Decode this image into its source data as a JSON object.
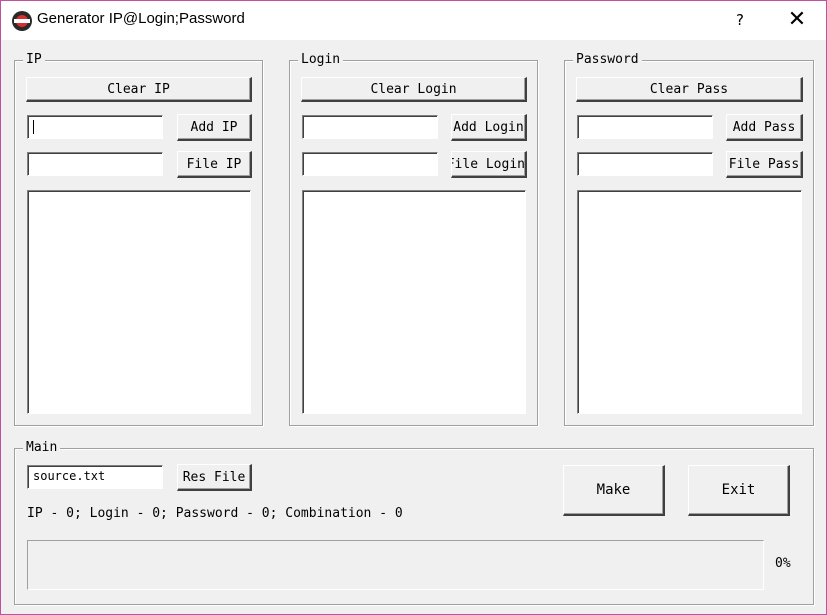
{
  "window": {
    "title": "Generator IP@Login;Password",
    "help_label": "?",
    "close_label": "✕"
  },
  "ip_group": {
    "legend": "IP",
    "clear_label": "Clear IP",
    "add_label": "Add IP",
    "file_label": "File IP",
    "add_value": "",
    "file_value": "",
    "items": []
  },
  "login_group": {
    "legend": "Login",
    "clear_label": "Clear Login",
    "add_label": "Add Login",
    "file_label": "File Login",
    "add_value": "",
    "file_value": "",
    "items": []
  },
  "password_group": {
    "legend": "Password",
    "clear_label": "Clear Pass",
    "add_label": "Add Pass",
    "file_label": "File Pass",
    "add_value": "",
    "file_value": "",
    "items": []
  },
  "main_group": {
    "legend": "Main",
    "result_file_value": "source.txt",
    "res_file_label": "Res File",
    "status_text": "IP - 0; Login - 0; Password - 0; Combination - 0",
    "make_label": "Make",
    "exit_label": "Exit",
    "progress_percent": 0,
    "progress_text": "0%"
  },
  "colors": {
    "window_bg": "#f0f0f0",
    "window_border": "#c050a0",
    "progress_fill": "#3060c0"
  },
  "icons": {
    "app": "red-disc-app-icon",
    "help": "question-mark-icon",
    "close": "close-icon"
  }
}
